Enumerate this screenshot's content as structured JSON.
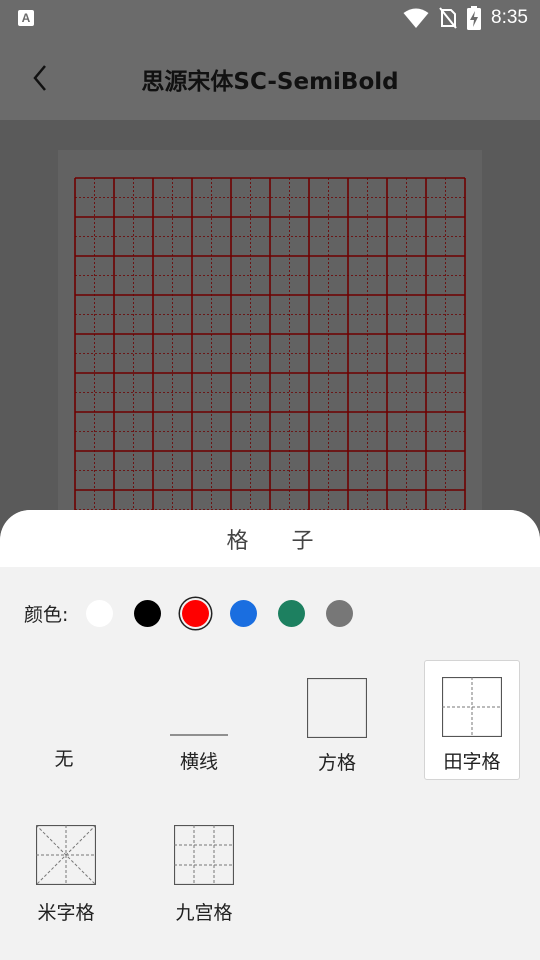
{
  "status": {
    "time": "8:35",
    "app_icon_letter": "A"
  },
  "header": {
    "title": "思源宋体SC-SemiBold"
  },
  "sheet": {
    "title": "格 子",
    "color_label": "颜色:",
    "colors": [
      {
        "name": "white",
        "hex": "#ffffff"
      },
      {
        "name": "black",
        "hex": "#000000"
      },
      {
        "name": "red",
        "hex": "#ff0000",
        "selected": true
      },
      {
        "name": "blue",
        "hex": "#1a6ee0"
      },
      {
        "name": "green",
        "hex": "#1d8060"
      },
      {
        "name": "gray",
        "hex": "#777777"
      }
    ],
    "options": [
      {
        "key": "none",
        "label": "无"
      },
      {
        "key": "lines",
        "label": "横线"
      },
      {
        "key": "square",
        "label": "方格"
      },
      {
        "key": "tian",
        "label": "田字格",
        "selected": true
      },
      {
        "key": "mi",
        "label": "米字格"
      },
      {
        "key": "jiugong",
        "label": "九宫格"
      }
    ]
  },
  "grid": {
    "line_color": "#6e0000",
    "cols": 10,
    "rows": 9
  }
}
